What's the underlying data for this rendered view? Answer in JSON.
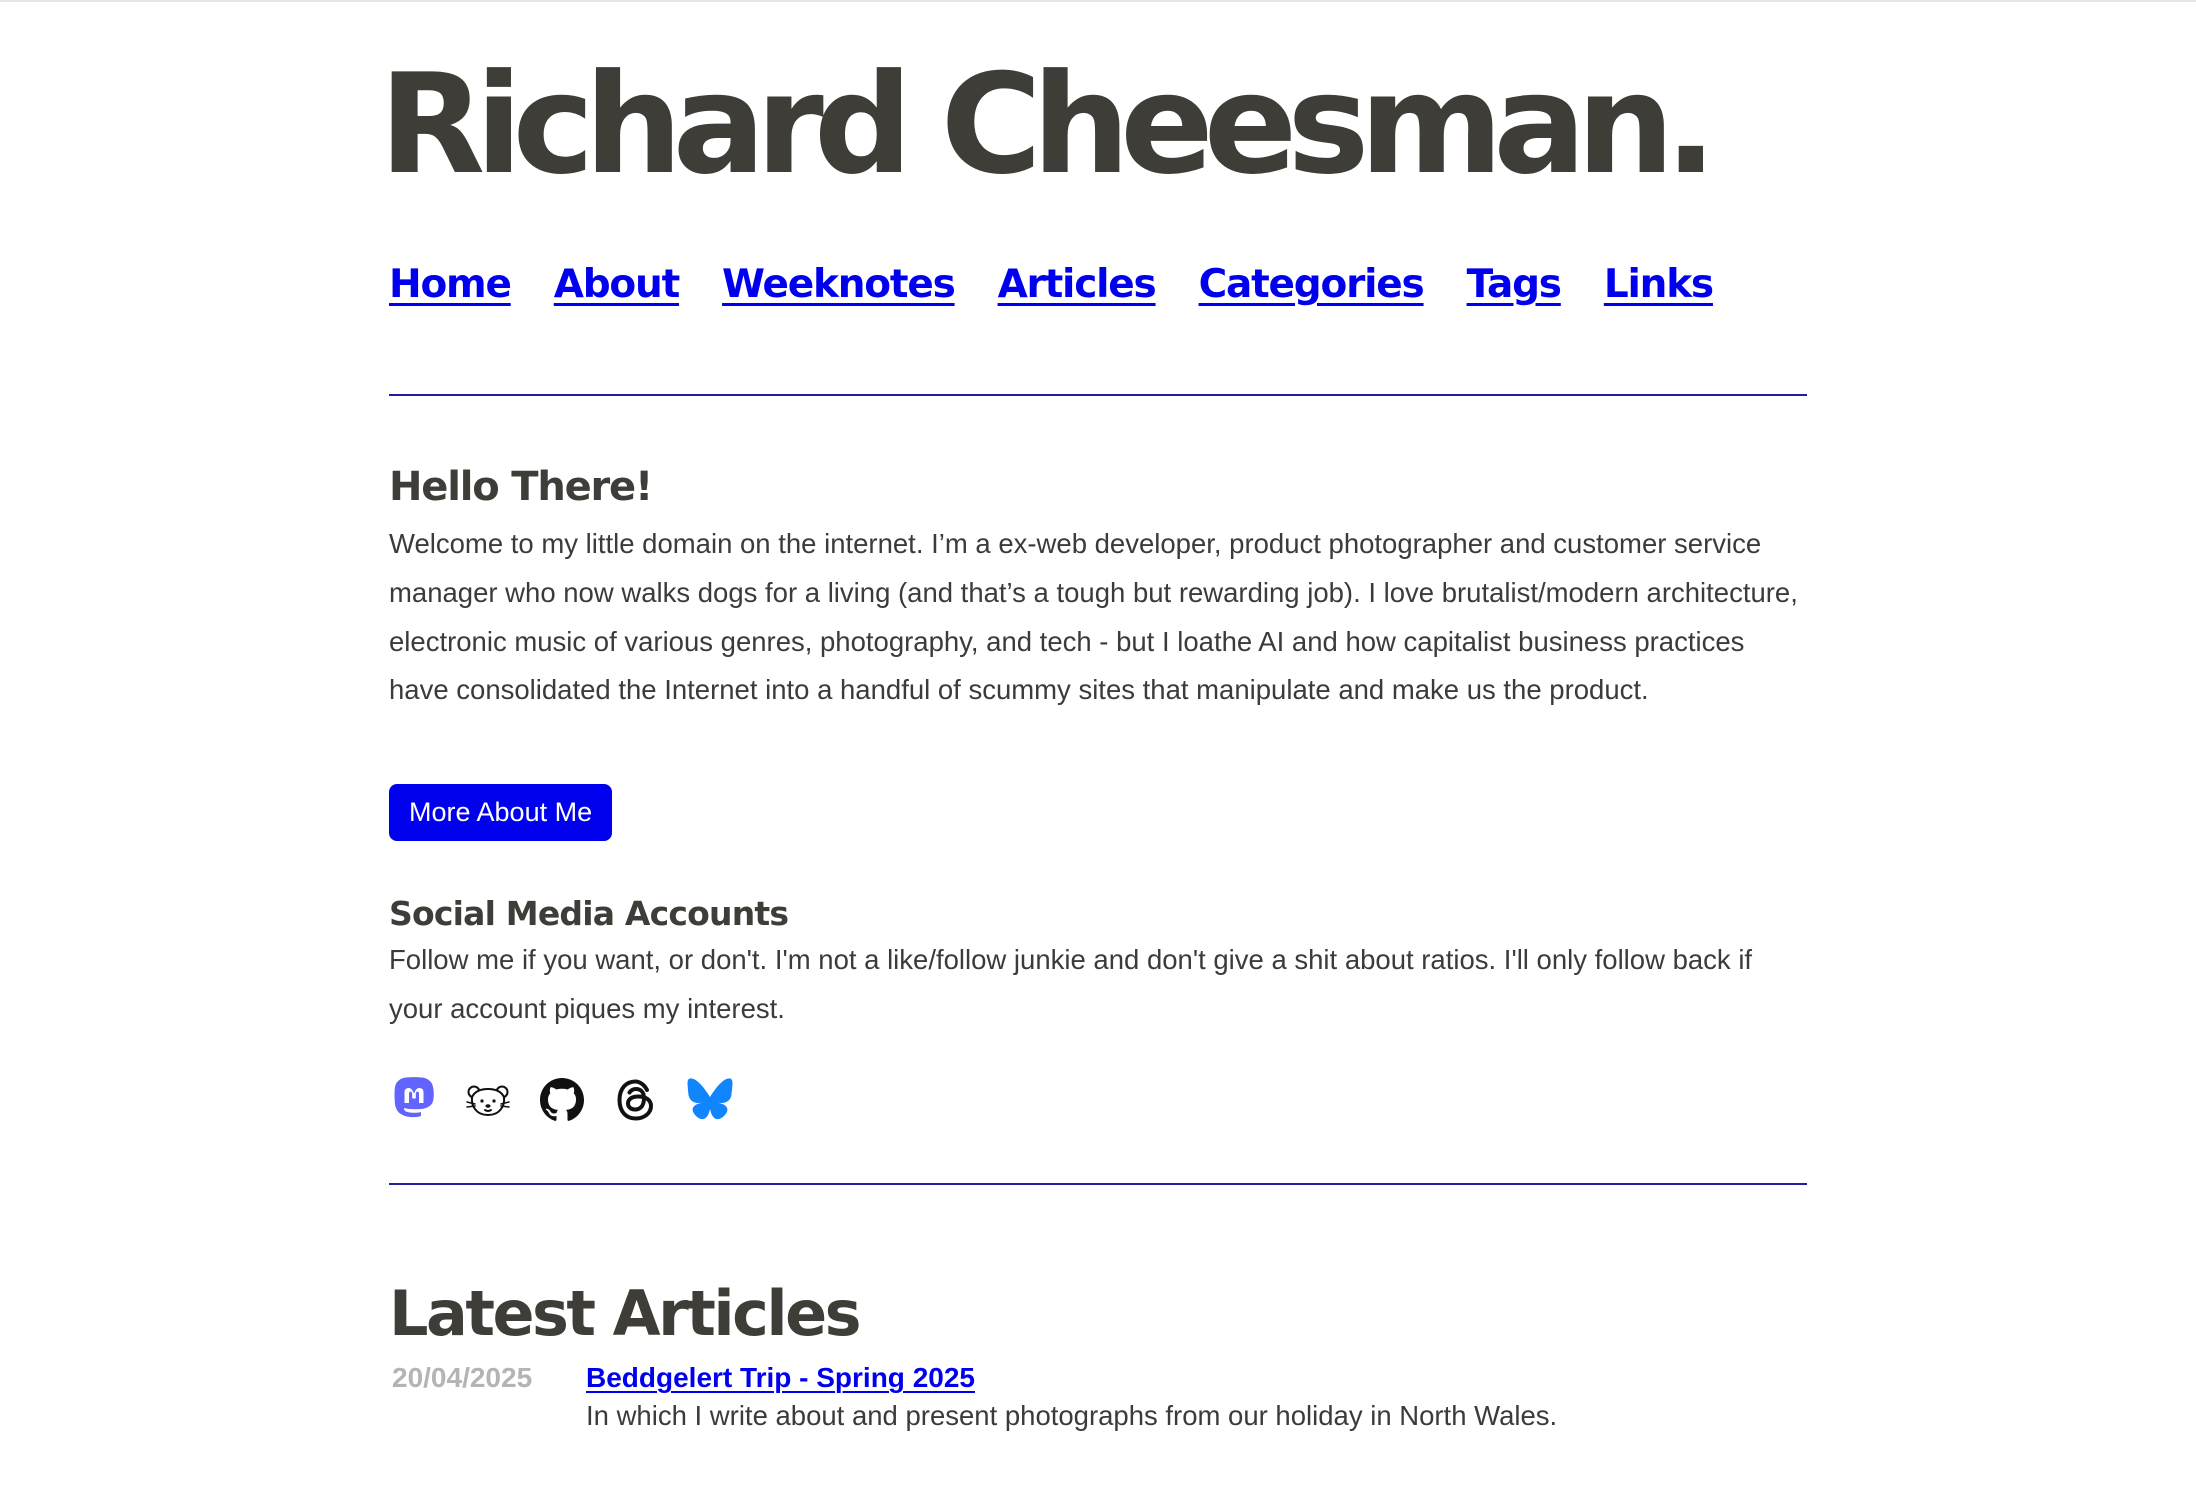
{
  "site": {
    "title": "Richard Cheesman",
    "title_dot": "."
  },
  "nav": {
    "items": [
      {
        "label": "Home"
      },
      {
        "label": "About"
      },
      {
        "label": "Weeknotes"
      },
      {
        "label": "Articles"
      },
      {
        "label": "Categories"
      },
      {
        "label": "Tags"
      },
      {
        "label": "Links"
      }
    ]
  },
  "intro": {
    "heading": "Hello There!",
    "text": "Welcome to my little domain on the internet. I’m a ex-web developer, product photographer and customer service manager who now walks dogs for a living (and that’s a tough but rewarding job). I love brutalist/modern architecture, electronic music of various genres, photography, and tech - but I loathe AI and how capitalist business practices have consolidated the Internet into a handful of scummy sites that manipulate and make us the product.",
    "button_label": "More About Me"
  },
  "social": {
    "heading": "Social Media Accounts",
    "text": "Follow me if you want, or don't. I'm not a like/follow junkie and don't give a shit about ratios. I'll only follow back if your account piques my interest.",
    "icons": [
      "mastodon-icon",
      "bear-icon",
      "github-icon",
      "threads-icon",
      "bluesky-icon"
    ]
  },
  "latest": {
    "heading": "Latest Articles",
    "articles": [
      {
        "date": "20/04/2025",
        "title": "Beddgelert Trip - Spring 2025",
        "description": "In which I write about and present photographs from our holiday in North Wales."
      }
    ]
  },
  "colors": {
    "link": "#0000ee",
    "text": "#3f3d38",
    "rule": "#1f1f9a",
    "date": "#b4b4b4",
    "mastodon": "#6364ff",
    "bluesky": "#1185fe"
  }
}
